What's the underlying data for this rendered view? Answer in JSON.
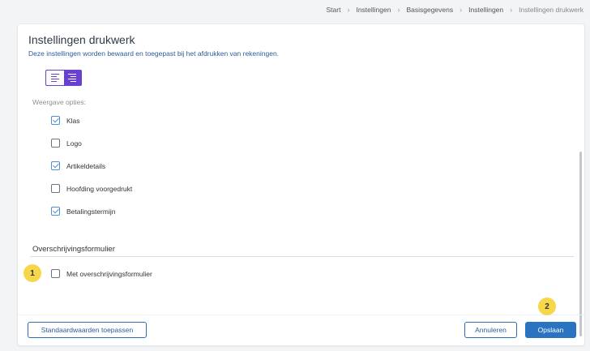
{
  "breadcrumb": {
    "items": [
      "Start",
      "Instellingen",
      "Basisgegevens",
      "Instellingen"
    ],
    "current": "Instellingen drukwerk"
  },
  "card": {
    "title": "Instellingen drukwerk",
    "subtitle": "Deze instellingen worden bewaard en toegepast bij het afdrukken van rekeningen."
  },
  "alignment": {
    "options": [
      "align-left",
      "align-right"
    ],
    "selected": "align-right"
  },
  "display_options": {
    "label": "Weergave opties:",
    "items": [
      {
        "label": "Klas",
        "checked": true
      },
      {
        "label": "Logo",
        "checked": false
      },
      {
        "label": "Artikeldetails",
        "checked": true
      },
      {
        "label": "Hoofding voorgedrukt",
        "checked": false
      },
      {
        "label": "Betalingstermijn",
        "checked": true
      }
    ]
  },
  "transfer_form": {
    "title": "Overschrijvingsformulier",
    "option": {
      "label": "Met overschrijvingsformulier",
      "checked": false
    }
  },
  "annotations": {
    "badge_1": "1",
    "badge_2": "2"
  },
  "footer": {
    "defaults_label": "Standaardwaarden toepassen",
    "cancel_label": "Annuleren",
    "save_label": "Opslaan"
  },
  "colors": {
    "accent_purple": "#6a3fd4",
    "primary_blue": "#2a73c0",
    "badge_yellow": "#f7d64a"
  }
}
